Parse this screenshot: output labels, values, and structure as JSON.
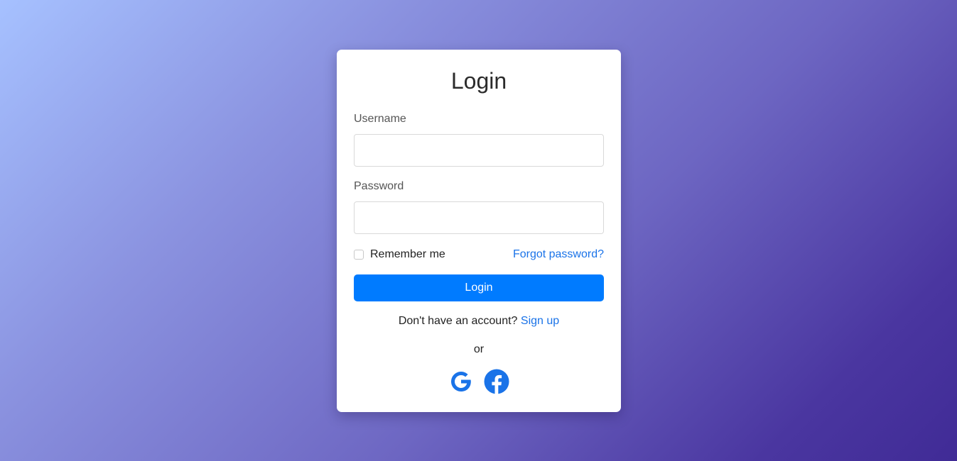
{
  "login": {
    "title": "Login",
    "username_label": "Username",
    "username_value": "",
    "password_label": "Password",
    "password_value": "",
    "remember_label": "Remember me",
    "remember_checked": false,
    "forgot_link": "Forgot password?",
    "submit_label": "Login",
    "signup_prompt": "Don't have an account?",
    "signup_link": "Sign up",
    "divider_text": "or",
    "social": [
      {
        "icon": "google-icon"
      },
      {
        "icon": "facebook-icon"
      }
    ]
  },
  "colors": {
    "accent": "#007bff",
    "link": "#1a73e8",
    "background_start": "#a6c1ff",
    "background_end": "#402b96",
    "social_icon": "#1a73e8"
  }
}
